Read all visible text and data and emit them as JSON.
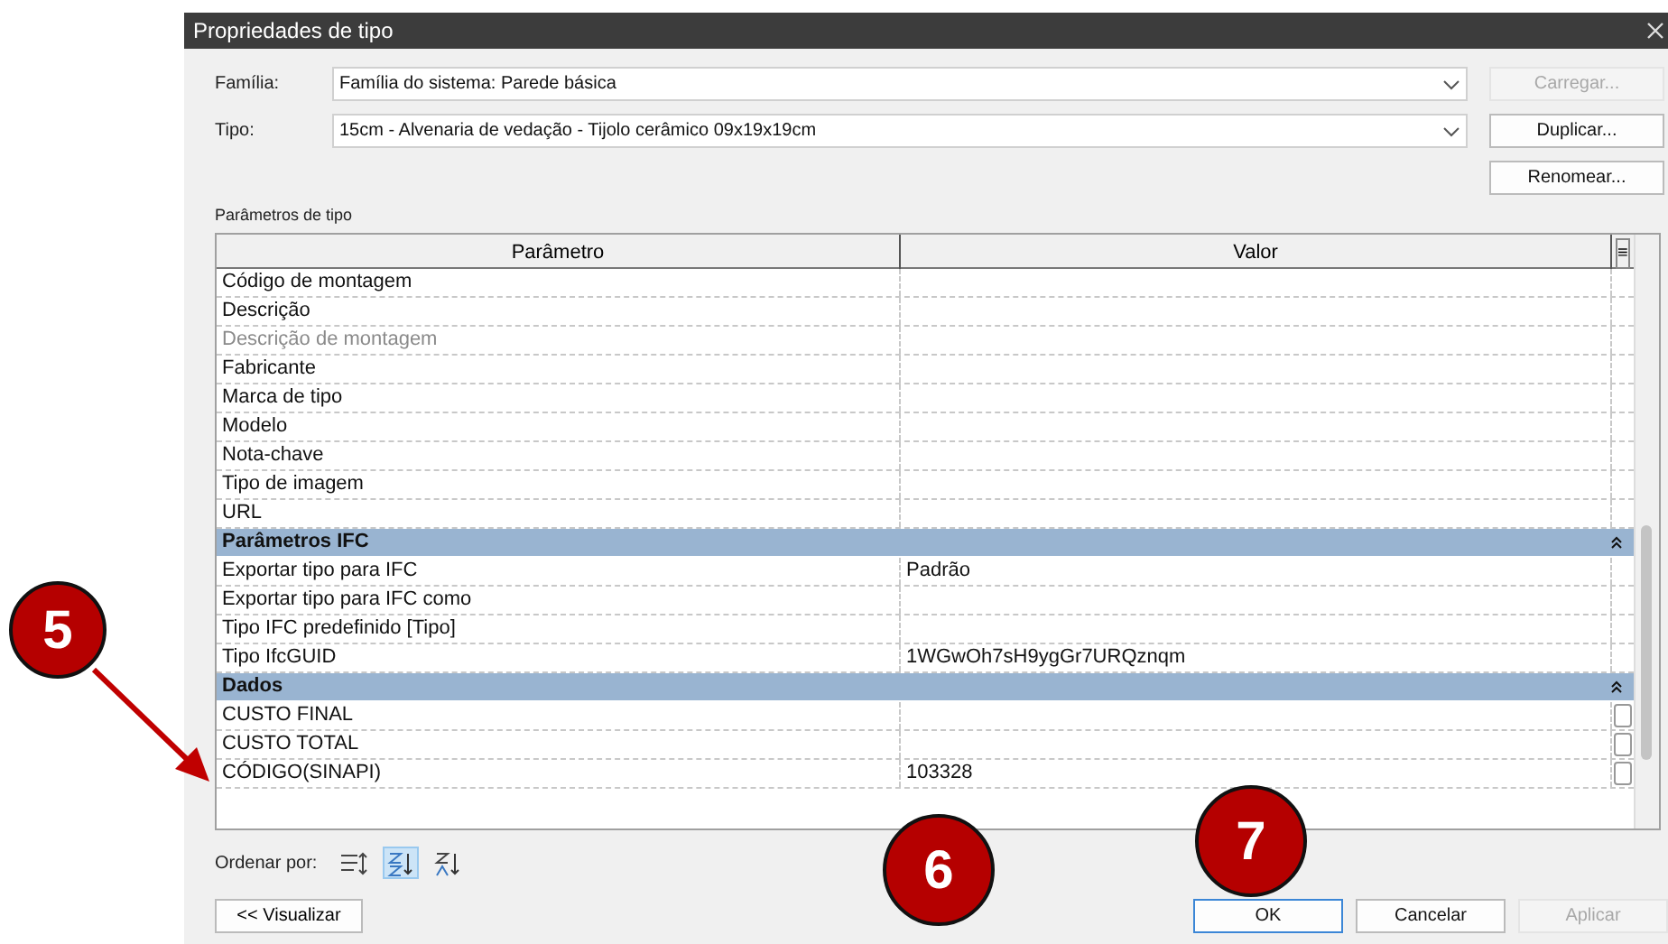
{
  "window": {
    "title": "Propriedades de tipo"
  },
  "family": {
    "label": "Família:",
    "value": "Família do sistema: Parede básica"
  },
  "type": {
    "label": "Tipo:",
    "value": "15cm - Alvenaria de vedação - Tijolo cerâmico 09x19x19cm"
  },
  "side_buttons": [
    {
      "label": "Carregar...",
      "disabled": true
    },
    {
      "label": "Duplicar...",
      "disabled": false
    },
    {
      "label": "Renomear...",
      "disabled": false
    }
  ],
  "section_label": "Parâmetros de tipo",
  "table": {
    "columns": [
      "Parâmetro",
      "Valor"
    ],
    "column_3": "≡",
    "rows": [
      {
        "kind": "param",
        "name": "Código de montagem",
        "disabled": false
      },
      {
        "kind": "param",
        "name": "Descrição",
        "disabled": false
      },
      {
        "kind": "param",
        "name": "Descrição de montagem",
        "disabled": true
      },
      {
        "kind": "param",
        "name": "Fabricante",
        "disabled": false
      },
      {
        "kind": "param",
        "name": "Marca de tipo",
        "disabled": false
      },
      {
        "kind": "param",
        "name": "Modelo",
        "disabled": false
      },
      {
        "kind": "param",
        "name": "Nota-chave",
        "disabled": false
      },
      {
        "kind": "param",
        "name": "Tipo de imagem",
        "disabled": false
      },
      {
        "kind": "param",
        "name": "URL",
        "disabled": false
      },
      {
        "kind": "group",
        "name": "Parâmetros IFC",
        "expanded": true
      },
      {
        "kind": "param",
        "name": "Exportar tipo para IFC",
        "value": "Padrão",
        "disabled": false
      },
      {
        "kind": "param",
        "name": "Exportar tipo para IFC como",
        "disabled": false
      },
      {
        "kind": "param",
        "name": "Tipo IFC predefinido [Tipo]",
        "disabled": false
      },
      {
        "kind": "param",
        "name": "Tipo IfcGUID",
        "value": "1WGwOh7sH9ygGr7URQznqm",
        "disabled": false
      },
      {
        "kind": "group",
        "name": "Dados",
        "expanded": true
      },
      {
        "kind": "check",
        "name": "CUSTO FINAL",
        "checked": false
      },
      {
        "kind": "check",
        "name": "CUSTO TOTAL",
        "checked": false
      },
      {
        "kind": "check",
        "name": "CÓDIGO(SINAPI)",
        "value": "103328",
        "checked": false
      }
    ]
  },
  "sort": {
    "label": "Ordenar por:",
    "options": [
      {
        "kind": "grouped",
        "selected": false
      },
      {
        "kind": "ascending",
        "selected": true
      },
      {
        "kind": "descending",
        "selected": false
      }
    ]
  },
  "preview_button": "<< Visualizar",
  "dialog_buttons": [
    {
      "label": "OK",
      "default": true,
      "disabled": false
    },
    {
      "label": "Cancelar",
      "default": false,
      "disabled": false
    },
    {
      "label": "Aplicar",
      "default": false,
      "disabled": true
    }
  ],
  "annotations": [
    {
      "label": "5",
      "arrow": true
    },
    {
      "label": "6",
      "arrow": false
    },
    {
      "label": "7",
      "arrow": false
    }
  ]
}
